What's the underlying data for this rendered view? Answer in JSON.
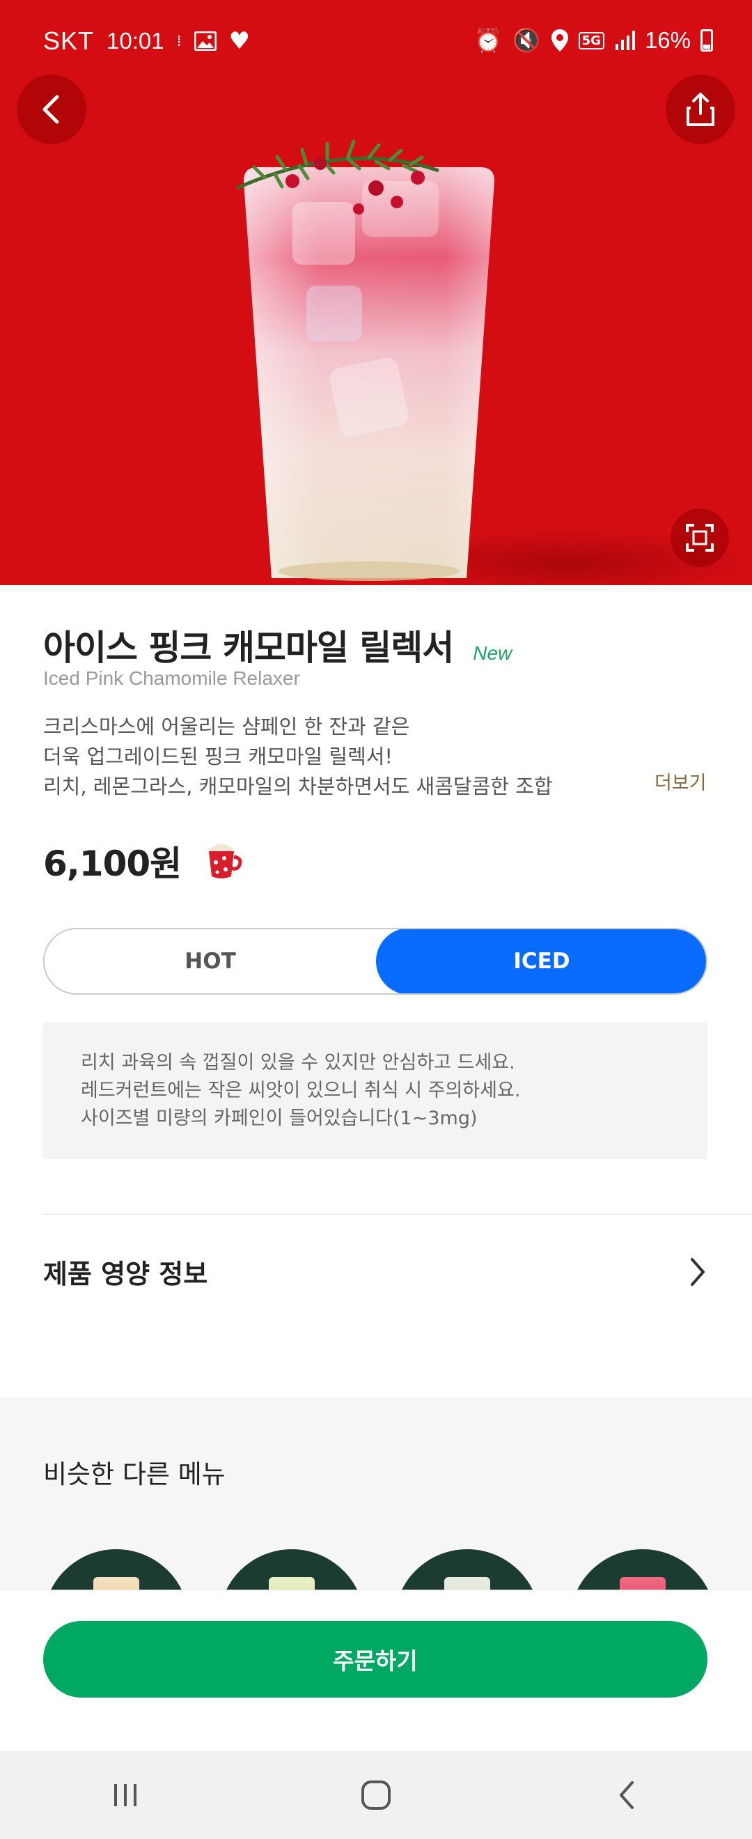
{
  "status_bar": {
    "carrier": "SKT",
    "time": "10:01",
    "network": "5G",
    "battery": "16%"
  },
  "product": {
    "name_ko": "아이스 핑크 캐모마일 릴렉서",
    "badge": "New",
    "name_en": "Iced Pink Chamomile Relaxer",
    "description": [
      "크리스마스에 어울리는 샴페인 한 잔과 같은",
      "더욱 업그레이드된 핑크 캐모마일 릴렉서!",
      "리치, 레몬그라스, 캐모마일의 차분하면서도 새콤달콤한 조합"
    ],
    "more_label": "더보기",
    "price": "6,100원"
  },
  "temperature_toggle": {
    "options": [
      "HOT",
      "ICED"
    ],
    "selected": "ICED"
  },
  "notice": [
    "리치 과육의 속 껍질이 있을 수 있지만 안심하고 드세요.",
    "레드커런트에는 작은 씨앗이 있으니 취식 시 주의하세요.",
    "사이즈별 미량의 카페인이 들어있습니다(1~3mg)"
  ],
  "nutrition": {
    "label": "제품 영양 정보"
  },
  "similar": {
    "title": "비슷한 다른 메뉴"
  },
  "order": {
    "label": "주문하기"
  },
  "colors": {
    "hero_bg": "#d30d12",
    "iced_selected": "#0a6cff",
    "order_button": "#00a862",
    "new_badge": "#1ea362",
    "more_link": "#8a6a3a"
  }
}
